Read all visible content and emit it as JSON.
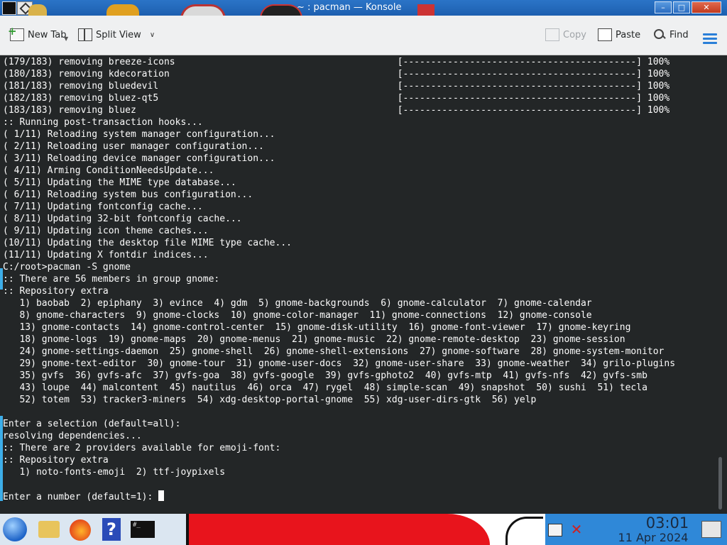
{
  "window": {
    "title": "~ : pacman — Konsole",
    "buttons": {
      "minimize": "–",
      "maximize": "□",
      "close": "✕"
    }
  },
  "toolbar": {
    "new_tab": "New Tab",
    "split_view": "Split View",
    "copy": "Copy",
    "paste": "Paste",
    "find": "Find"
  },
  "terminal": {
    "lines": [
      "(179/183) removing breeze-icons                                        [------------------------------------------] 100%",
      "(180/183) removing kdecoration                                         [------------------------------------------] 100%",
      "(181/183) removing bluedevil                                           [------------------------------------------] 100%",
      "(182/183) removing bluez-qt5                                           [------------------------------------------] 100%",
      "(183/183) removing bluez                                               [------------------------------------------] 100%",
      ":: Running post-transaction hooks...",
      "( 1/11) Reloading system manager configuration...",
      "( 2/11) Reloading user manager configuration...",
      "( 3/11) Reloading device manager configuration...",
      "( 4/11) Arming ConditionNeedsUpdate...",
      "( 5/11) Updating the MIME type database...",
      "( 6/11) Reloading system bus configuration...",
      "( 7/11) Updating fontconfig cache...",
      "( 8/11) Updating 32-bit fontconfig cache...",
      "( 9/11) Updating icon theme caches...",
      "(10/11) Updating the desktop file MIME type cache...",
      "(11/11) Updating X fontdir indices...",
      "C:/root>pacman -S gnome",
      ":: There are 56 members in group gnome:",
      ":: Repository extra",
      "   1) baobab  2) epiphany  3) evince  4) gdm  5) gnome-backgrounds  6) gnome-calculator  7) gnome-calendar",
      "   8) gnome-characters  9) gnome-clocks  10) gnome-color-manager  11) gnome-connections  12) gnome-console",
      "   13) gnome-contacts  14) gnome-control-center  15) gnome-disk-utility  16) gnome-font-viewer  17) gnome-keyring",
      "   18) gnome-logs  19) gnome-maps  20) gnome-menus  21) gnome-music  22) gnome-remote-desktop  23) gnome-session",
      "   24) gnome-settings-daemon  25) gnome-shell  26) gnome-shell-extensions  27) gnome-software  28) gnome-system-monitor",
      "   29) gnome-text-editor  30) gnome-tour  31) gnome-user-docs  32) gnome-user-share  33) gnome-weather  34) grilo-plugins",
      "   35) gvfs  36) gvfs-afc  37) gvfs-goa  38) gvfs-google  39) gvfs-gphoto2  40) gvfs-mtp  41) gvfs-nfs  42) gvfs-smb",
      "   43) loupe  44) malcontent  45) nautilus  46) orca  47) rygel  48) simple-scan  49) snapshot  50) sushi  51) tecla",
      "   52) totem  53) tracker3-miners  54) xdg-desktop-portal-gnome  55) xdg-user-dirs-gtk  56) yelp",
      "",
      "Enter a selection (default=all):",
      "resolving dependencies...",
      ":: There are 2 providers available for emoji-font:",
      ":: Repository extra",
      "   1) noto-fonts-emoji  2) ttf-joypixels",
      ""
    ],
    "prompt": "Enter a number (default=1): "
  },
  "taskbar": {
    "konsole_label": "#_",
    "help_label": "?",
    "clock_time": "03:01",
    "clock_date": "11 Apr 2024"
  },
  "icons": [
    "konsole-icon",
    "window-menu-icon",
    "new-tab-icon",
    "split-view-icon",
    "chevron-down-icon",
    "copy-icon",
    "paste-icon",
    "search-icon",
    "hamburger-menu-icon",
    "start-orb-icon",
    "folder-icon",
    "firefox-icon",
    "help-icon",
    "konsole-taskbar-icon",
    "network-icon",
    "volume-muted-icon",
    "show-desktop-icon"
  ]
}
